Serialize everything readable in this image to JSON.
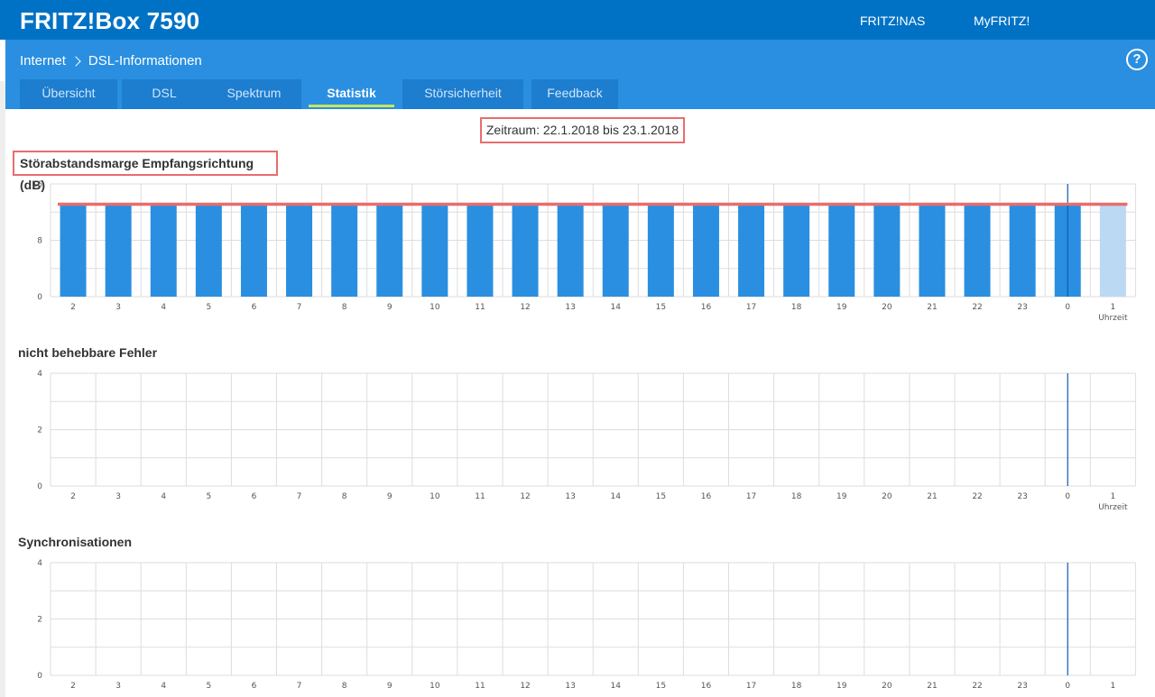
{
  "header": {
    "brand": "FRITZ!Box 7590",
    "links": [
      "FRITZ!NAS",
      "MyFRITZ!"
    ]
  },
  "breadcrumb": {
    "parent": "Internet",
    "current": "DSL-Informationen"
  },
  "help_label": "?",
  "tabs": [
    {
      "label": "Übersicht",
      "active": false
    },
    {
      "label": "DSL",
      "active": false
    },
    {
      "label": "Spektrum",
      "active": false
    },
    {
      "label": "Statistik",
      "active": true
    },
    {
      "label": "Störsicherheit",
      "active": false
    },
    {
      "label": "Feedback",
      "active": false
    }
  ],
  "zeitraum": "Zeitraum: 22.1.2018 bis 23.1.2018",
  "colors": {
    "bar": "#2a8fe0",
    "bar_current": "#bcd9f3",
    "threshold": "#e86d6d",
    "marker": "#0b5cad",
    "grid": "#dddddd"
  },
  "chart_data": [
    {
      "type": "bar",
      "title": "Störabstandsmarge Empfangsrichtung (dB)",
      "xlabel": "Uhrzeit",
      "categories": [
        "2",
        "3",
        "4",
        "5",
        "6",
        "7",
        "8",
        "9",
        "10",
        "11",
        "12",
        "13",
        "14",
        "15",
        "16",
        "17",
        "18",
        "19",
        "20",
        "21",
        "22",
        "23",
        "0",
        "1"
      ],
      "values": [
        13,
        13,
        13,
        13,
        13,
        13,
        13,
        13,
        13,
        13,
        13,
        13,
        13,
        13,
        13,
        13,
        13,
        13,
        13,
        13,
        13,
        13,
        13,
        13
      ],
      "yticks": [
        0,
        8,
        16
      ],
      "ylim": [
        0,
        16
      ],
      "threshold": 13,
      "current_index": 23,
      "marker_category": "0",
      "grid": true
    },
    {
      "type": "bar",
      "title": "nicht behebbare Fehler",
      "xlabel": "Uhrzeit",
      "categories": [
        "2",
        "3",
        "4",
        "5",
        "6",
        "7",
        "8",
        "9",
        "10",
        "11",
        "12",
        "13",
        "14",
        "15",
        "16",
        "17",
        "18",
        "19",
        "20",
        "21",
        "22",
        "23",
        "0",
        "1"
      ],
      "values": [
        0,
        0,
        0,
        0,
        0,
        0,
        0,
        0,
        0,
        0,
        0,
        0,
        0,
        0,
        0,
        0,
        0,
        0,
        0,
        0,
        0,
        0,
        0,
        0
      ],
      "yticks": [
        0,
        2,
        4
      ],
      "ylim": [
        0,
        4
      ],
      "marker_category": "0",
      "grid": true
    },
    {
      "type": "bar",
      "title": "Synchronisationen",
      "xlabel": "",
      "categories": [
        "2",
        "3",
        "4",
        "5",
        "6",
        "7",
        "8",
        "9",
        "10",
        "11",
        "12",
        "13",
        "14",
        "15",
        "16",
        "17",
        "18",
        "19",
        "20",
        "21",
        "22",
        "23",
        "0",
        "1"
      ],
      "values": [
        0,
        0,
        0,
        0,
        0,
        0,
        0,
        0,
        0,
        0,
        0,
        0,
        0,
        0,
        0,
        0,
        0,
        0,
        0,
        0,
        0,
        0,
        0,
        0
      ],
      "yticks": [
        0,
        2,
        4
      ],
      "ylim": [
        0,
        4
      ],
      "marker_category": "0",
      "grid": true
    }
  ]
}
